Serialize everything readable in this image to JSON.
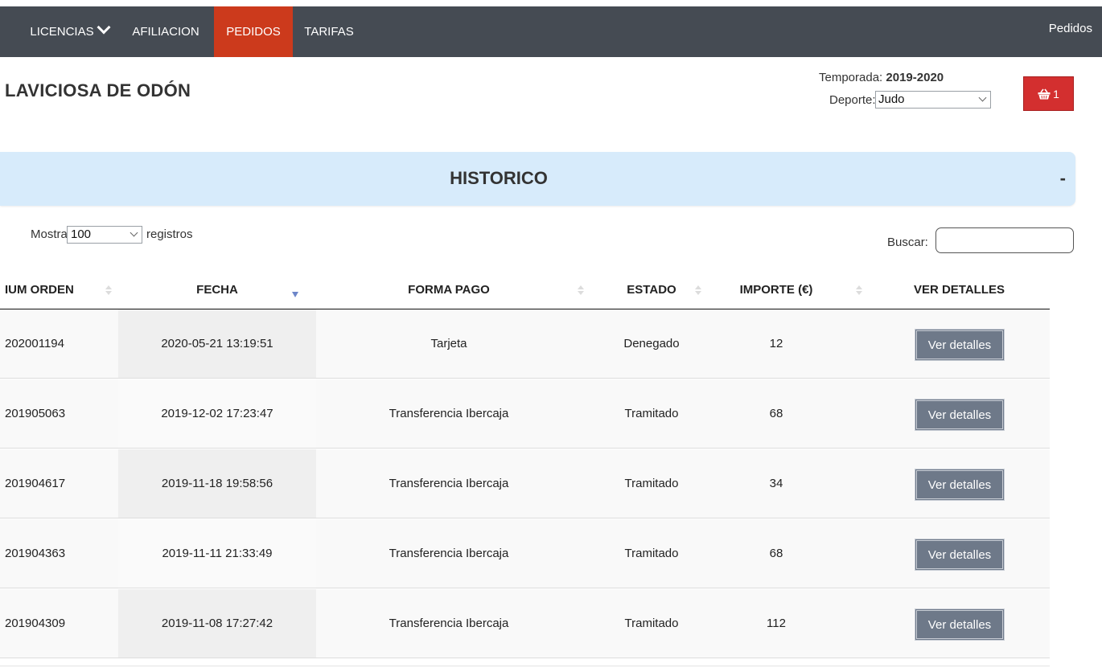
{
  "nav": {
    "items": [
      {
        "label": "LICENCIAS",
        "has_dropdown": true,
        "active": false
      },
      {
        "label": "AFILIACION",
        "has_dropdown": false,
        "active": false
      },
      {
        "label": "PEDIDOS",
        "has_dropdown": false,
        "active": true
      },
      {
        "label": "TARIFAS",
        "has_dropdown": false,
        "active": false
      }
    ],
    "right_label": "Pedidos",
    "bg_color": "#454b53",
    "active_color": "#cc3a1c"
  },
  "header": {
    "club_name": "LAVICIOSA DE ODÓN",
    "temporada_label": "Temporada:",
    "temporada_value": "2019-2020",
    "deporte_label": "Deporte:",
    "deporte_value": "Judo",
    "cart_icon": "shopping-basket-icon",
    "cart_count": "1"
  },
  "panel": {
    "title": "HISTORICO",
    "collapse_symbol": "-"
  },
  "table_controls": {
    "mostrar_label": "Mostrar",
    "page_length": "100",
    "registros_label": "registros",
    "buscar_label": "Buscar:",
    "search_value": ""
  },
  "table": {
    "columns": [
      "IUM ORDEN",
      "FECHA",
      "FORMA PAGO",
      "ESTADO",
      "IMPORTE (€)",
      "VER DETALLES"
    ],
    "sorted_column": "FECHA",
    "sort_direction": "desc",
    "rows": [
      {
        "num": "202001194",
        "fecha": "2020-05-21 13:19:51",
        "forma": "Tarjeta",
        "estado": "Denegado",
        "importe": "12",
        "btn": "Ver detalles"
      },
      {
        "num": "201905063",
        "fecha": "2019-12-02 17:23:47",
        "forma": "Transferencia Ibercaja",
        "estado": "Tramitado",
        "importe": "68",
        "btn": "Ver detalles"
      },
      {
        "num": "201904617",
        "fecha": "2019-11-18 19:58:56",
        "forma": "Transferencia Ibercaja",
        "estado": "Tramitado",
        "importe": "34",
        "btn": "Ver detalles"
      },
      {
        "num": "201904363",
        "fecha": "2019-11-11 21:33:49",
        "forma": "Transferencia Ibercaja",
        "estado": "Tramitado",
        "importe": "68",
        "btn": "Ver detalles"
      },
      {
        "num": "201904309",
        "fecha": "2019-11-08 17:27:42",
        "forma": "Transferencia Ibercaja",
        "estado": "Tramitado",
        "importe": "112",
        "btn": "Ver detalles"
      }
    ]
  }
}
